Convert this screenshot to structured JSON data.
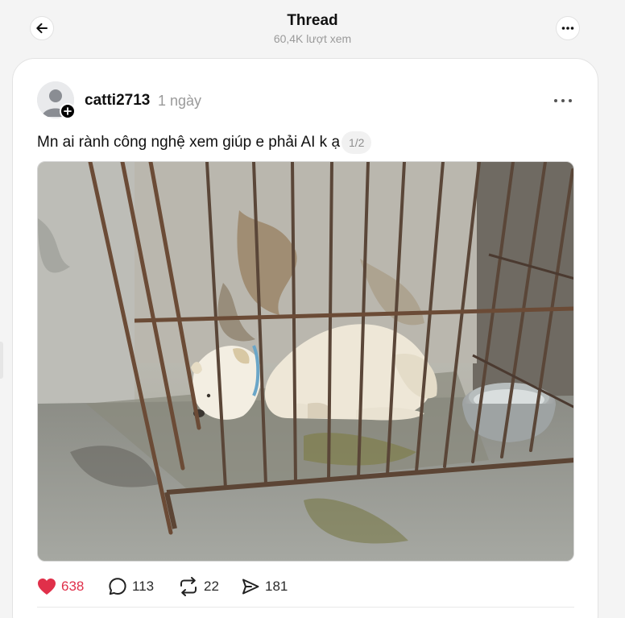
{
  "header": {
    "title": "Thread",
    "views": "60,4K lượt xem",
    "back_icon": "arrow-left-icon",
    "more_icon": "ellipsis-icon"
  },
  "post": {
    "username": "catti2713",
    "time": "1 ngày",
    "text": "Mn ai rành công nghệ xem giúp e phải AI k ạ",
    "page_indicator": "1/2",
    "image_icon": "photo-dog-in-cage"
  },
  "actions": {
    "likes": "638",
    "replies": "113",
    "reposts": "22",
    "shares": "181"
  },
  "colors": {
    "like": "#e0304a",
    "background": "#f4f4f4",
    "card": "#ffffff"
  }
}
